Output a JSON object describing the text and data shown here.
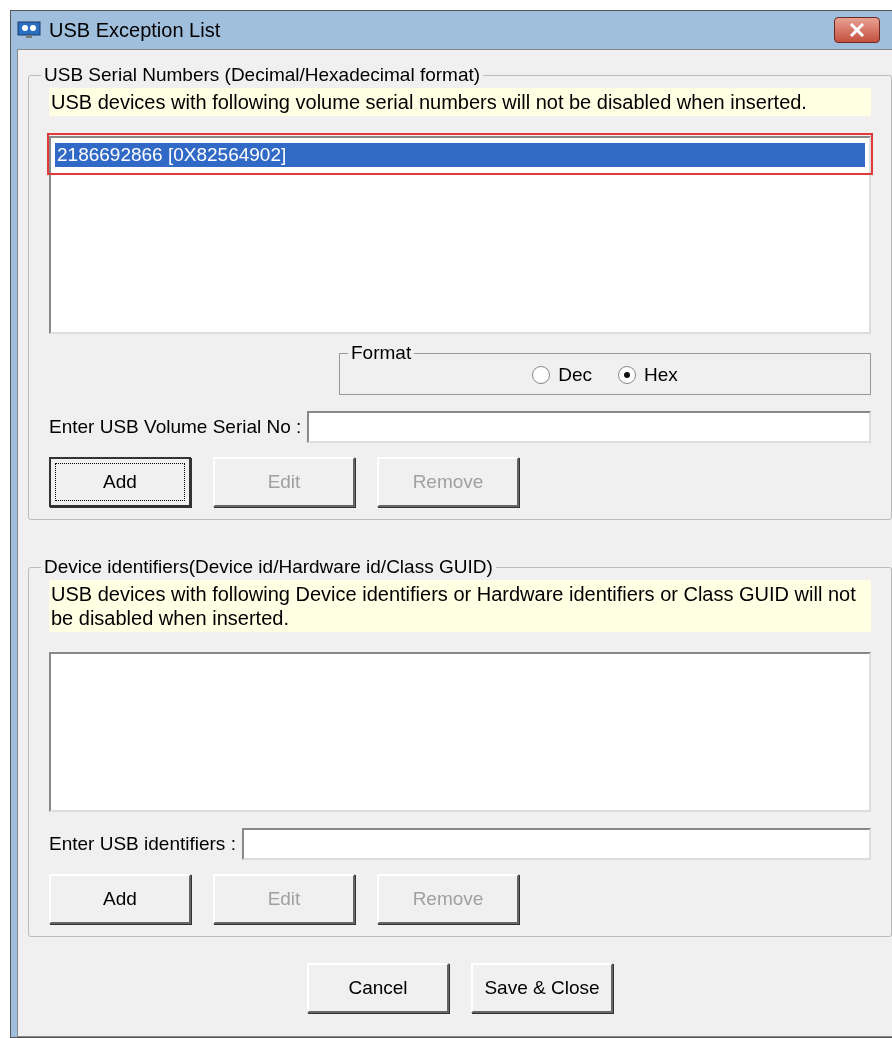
{
  "window": {
    "title": "USB Exception List"
  },
  "serial_group": {
    "legend": "USB Serial Numbers (Decimal/Hexadecimal format)",
    "note": "USB devices with following volume serial numbers will not be disabled when inserted.",
    "items": [
      {
        "text": "2186692866 [0X82564902]",
        "selected": true,
        "highlighted": true
      }
    ],
    "format": {
      "legend": "Format",
      "options": [
        {
          "label": "Dec",
          "selected": false
        },
        {
          "label": "Hex",
          "selected": true
        }
      ]
    },
    "input_label": "Enter USB Volume Serial No :",
    "buttons": [
      {
        "label": "Add",
        "disabled": false,
        "focused": true
      },
      {
        "label": "Edit",
        "disabled": true,
        "focused": false
      },
      {
        "label": "Remove",
        "disabled": true,
        "focused": false
      }
    ]
  },
  "identifier_group": {
    "legend": "Device identifiers(Device id/Hardware id/Class GUID)",
    "note": "USB devices with following Device identifiers or Hardware identifiers or Class GUID will not be disabled when inserted.",
    "input_label": "Enter USB identifiers :",
    "buttons": [
      {
        "label": "Add",
        "disabled": false,
        "focused": false
      },
      {
        "label": "Edit",
        "disabled": true,
        "focused": false
      },
      {
        "label": "Remove",
        "disabled": true,
        "focused": false
      }
    ]
  },
  "footer_buttons": [
    {
      "label": "Cancel",
      "disabled": false,
      "focused": false
    },
    {
      "label": "Save & Close",
      "disabled": false,
      "focused": false
    }
  ]
}
